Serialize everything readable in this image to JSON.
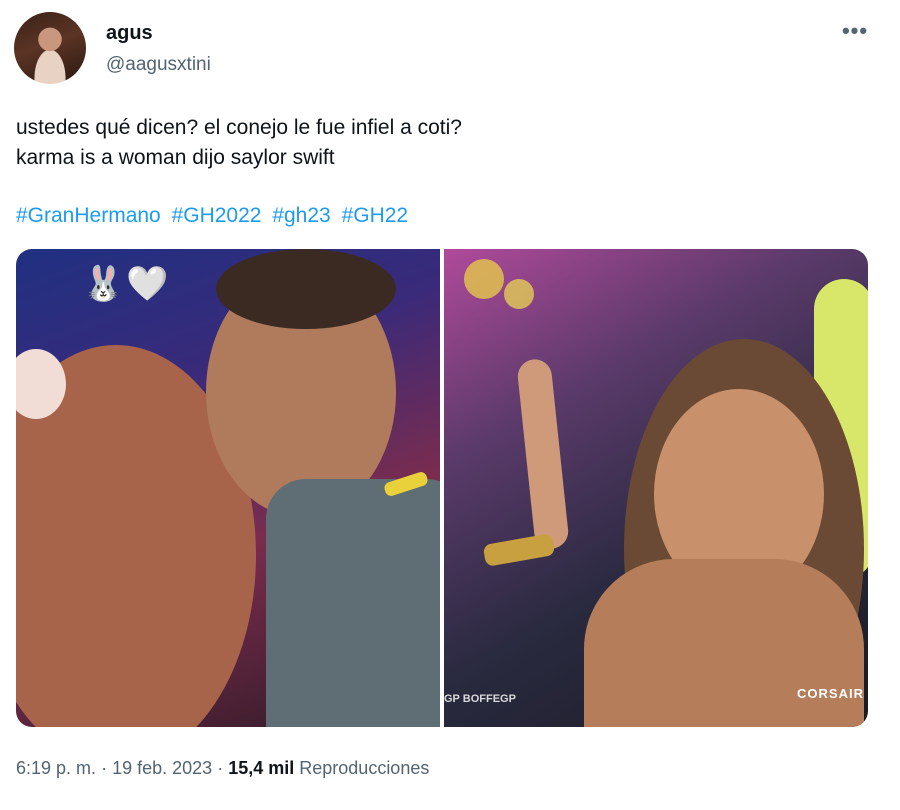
{
  "user": {
    "display_name": "agus",
    "handle": "@aagusxtini"
  },
  "more_icon": "more-horizontal-icon",
  "tweet": {
    "lines": [
      "ustedes qué dicen? el conejo le fue infiel a coti?",
      "karma is a woman dijo saylor swift"
    ],
    "hashtags": [
      "#GranHermano",
      "#GH2022",
      "#gh23",
      "#GH22"
    ]
  },
  "media": {
    "left_photo_emojis": [
      "🐰",
      "🤍"
    ],
    "right_photo_watermark": "CORSAIR",
    "right_photo_overlay": "GP  BOFFEGP"
  },
  "meta": {
    "time": "6:19 p. m.",
    "separator": "·",
    "date": "19 feb. 2023",
    "views_count": "15,4 mil",
    "views_label": "Reproducciones"
  },
  "colors": {
    "accent": "#1d9bf0",
    "text": "#0f1419",
    "secondary": "#536471"
  }
}
